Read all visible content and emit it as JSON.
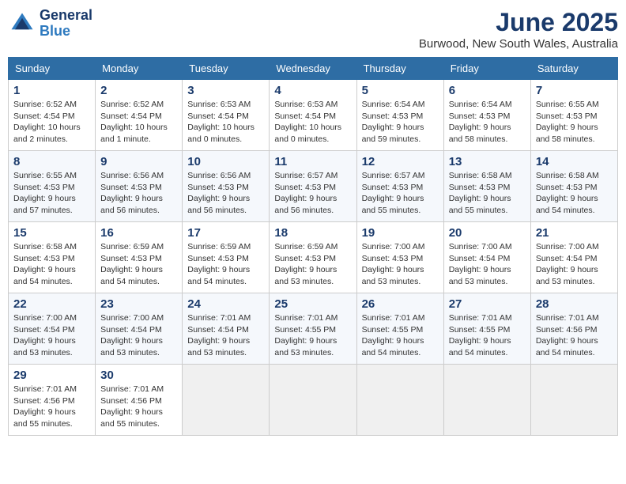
{
  "logo": {
    "line1": "General",
    "line2": "Blue"
  },
  "title": "June 2025",
  "location": "Burwood, New South Wales, Australia",
  "weekdays": [
    "Sunday",
    "Monday",
    "Tuesday",
    "Wednesday",
    "Thursday",
    "Friday",
    "Saturday"
  ],
  "weeks": [
    [
      {
        "day": "1",
        "info": "Sunrise: 6:52 AM\nSunset: 4:54 PM\nDaylight: 10 hours\nand 2 minutes."
      },
      {
        "day": "2",
        "info": "Sunrise: 6:52 AM\nSunset: 4:54 PM\nDaylight: 10 hours\nand 1 minute."
      },
      {
        "day": "3",
        "info": "Sunrise: 6:53 AM\nSunset: 4:54 PM\nDaylight: 10 hours\nand 0 minutes."
      },
      {
        "day": "4",
        "info": "Sunrise: 6:53 AM\nSunset: 4:54 PM\nDaylight: 10 hours\nand 0 minutes."
      },
      {
        "day": "5",
        "info": "Sunrise: 6:54 AM\nSunset: 4:53 PM\nDaylight: 9 hours\nand 59 minutes."
      },
      {
        "day": "6",
        "info": "Sunrise: 6:54 AM\nSunset: 4:53 PM\nDaylight: 9 hours\nand 58 minutes."
      },
      {
        "day": "7",
        "info": "Sunrise: 6:55 AM\nSunset: 4:53 PM\nDaylight: 9 hours\nand 58 minutes."
      }
    ],
    [
      {
        "day": "8",
        "info": "Sunrise: 6:55 AM\nSunset: 4:53 PM\nDaylight: 9 hours\nand 57 minutes."
      },
      {
        "day": "9",
        "info": "Sunrise: 6:56 AM\nSunset: 4:53 PM\nDaylight: 9 hours\nand 56 minutes."
      },
      {
        "day": "10",
        "info": "Sunrise: 6:56 AM\nSunset: 4:53 PM\nDaylight: 9 hours\nand 56 minutes."
      },
      {
        "day": "11",
        "info": "Sunrise: 6:57 AM\nSunset: 4:53 PM\nDaylight: 9 hours\nand 56 minutes."
      },
      {
        "day": "12",
        "info": "Sunrise: 6:57 AM\nSunset: 4:53 PM\nDaylight: 9 hours\nand 55 minutes."
      },
      {
        "day": "13",
        "info": "Sunrise: 6:58 AM\nSunset: 4:53 PM\nDaylight: 9 hours\nand 55 minutes."
      },
      {
        "day": "14",
        "info": "Sunrise: 6:58 AM\nSunset: 4:53 PM\nDaylight: 9 hours\nand 54 minutes."
      }
    ],
    [
      {
        "day": "15",
        "info": "Sunrise: 6:58 AM\nSunset: 4:53 PM\nDaylight: 9 hours\nand 54 minutes."
      },
      {
        "day": "16",
        "info": "Sunrise: 6:59 AM\nSunset: 4:53 PM\nDaylight: 9 hours\nand 54 minutes."
      },
      {
        "day": "17",
        "info": "Sunrise: 6:59 AM\nSunset: 4:53 PM\nDaylight: 9 hours\nand 54 minutes."
      },
      {
        "day": "18",
        "info": "Sunrise: 6:59 AM\nSunset: 4:53 PM\nDaylight: 9 hours\nand 53 minutes."
      },
      {
        "day": "19",
        "info": "Sunrise: 7:00 AM\nSunset: 4:53 PM\nDaylight: 9 hours\nand 53 minutes."
      },
      {
        "day": "20",
        "info": "Sunrise: 7:00 AM\nSunset: 4:54 PM\nDaylight: 9 hours\nand 53 minutes."
      },
      {
        "day": "21",
        "info": "Sunrise: 7:00 AM\nSunset: 4:54 PM\nDaylight: 9 hours\nand 53 minutes."
      }
    ],
    [
      {
        "day": "22",
        "info": "Sunrise: 7:00 AM\nSunset: 4:54 PM\nDaylight: 9 hours\nand 53 minutes."
      },
      {
        "day": "23",
        "info": "Sunrise: 7:00 AM\nSunset: 4:54 PM\nDaylight: 9 hours\nand 53 minutes."
      },
      {
        "day": "24",
        "info": "Sunrise: 7:01 AM\nSunset: 4:54 PM\nDaylight: 9 hours\nand 53 minutes."
      },
      {
        "day": "25",
        "info": "Sunrise: 7:01 AM\nSunset: 4:55 PM\nDaylight: 9 hours\nand 53 minutes."
      },
      {
        "day": "26",
        "info": "Sunrise: 7:01 AM\nSunset: 4:55 PM\nDaylight: 9 hours\nand 54 minutes."
      },
      {
        "day": "27",
        "info": "Sunrise: 7:01 AM\nSunset: 4:55 PM\nDaylight: 9 hours\nand 54 minutes."
      },
      {
        "day": "28",
        "info": "Sunrise: 7:01 AM\nSunset: 4:56 PM\nDaylight: 9 hours\nand 54 minutes."
      }
    ],
    [
      {
        "day": "29",
        "info": "Sunrise: 7:01 AM\nSunset: 4:56 PM\nDaylight: 9 hours\nand 55 minutes."
      },
      {
        "day": "30",
        "info": "Sunrise: 7:01 AM\nSunset: 4:56 PM\nDaylight: 9 hours\nand 55 minutes."
      },
      {
        "day": "",
        "info": ""
      },
      {
        "day": "",
        "info": ""
      },
      {
        "day": "",
        "info": ""
      },
      {
        "day": "",
        "info": ""
      },
      {
        "day": "",
        "info": ""
      }
    ]
  ]
}
